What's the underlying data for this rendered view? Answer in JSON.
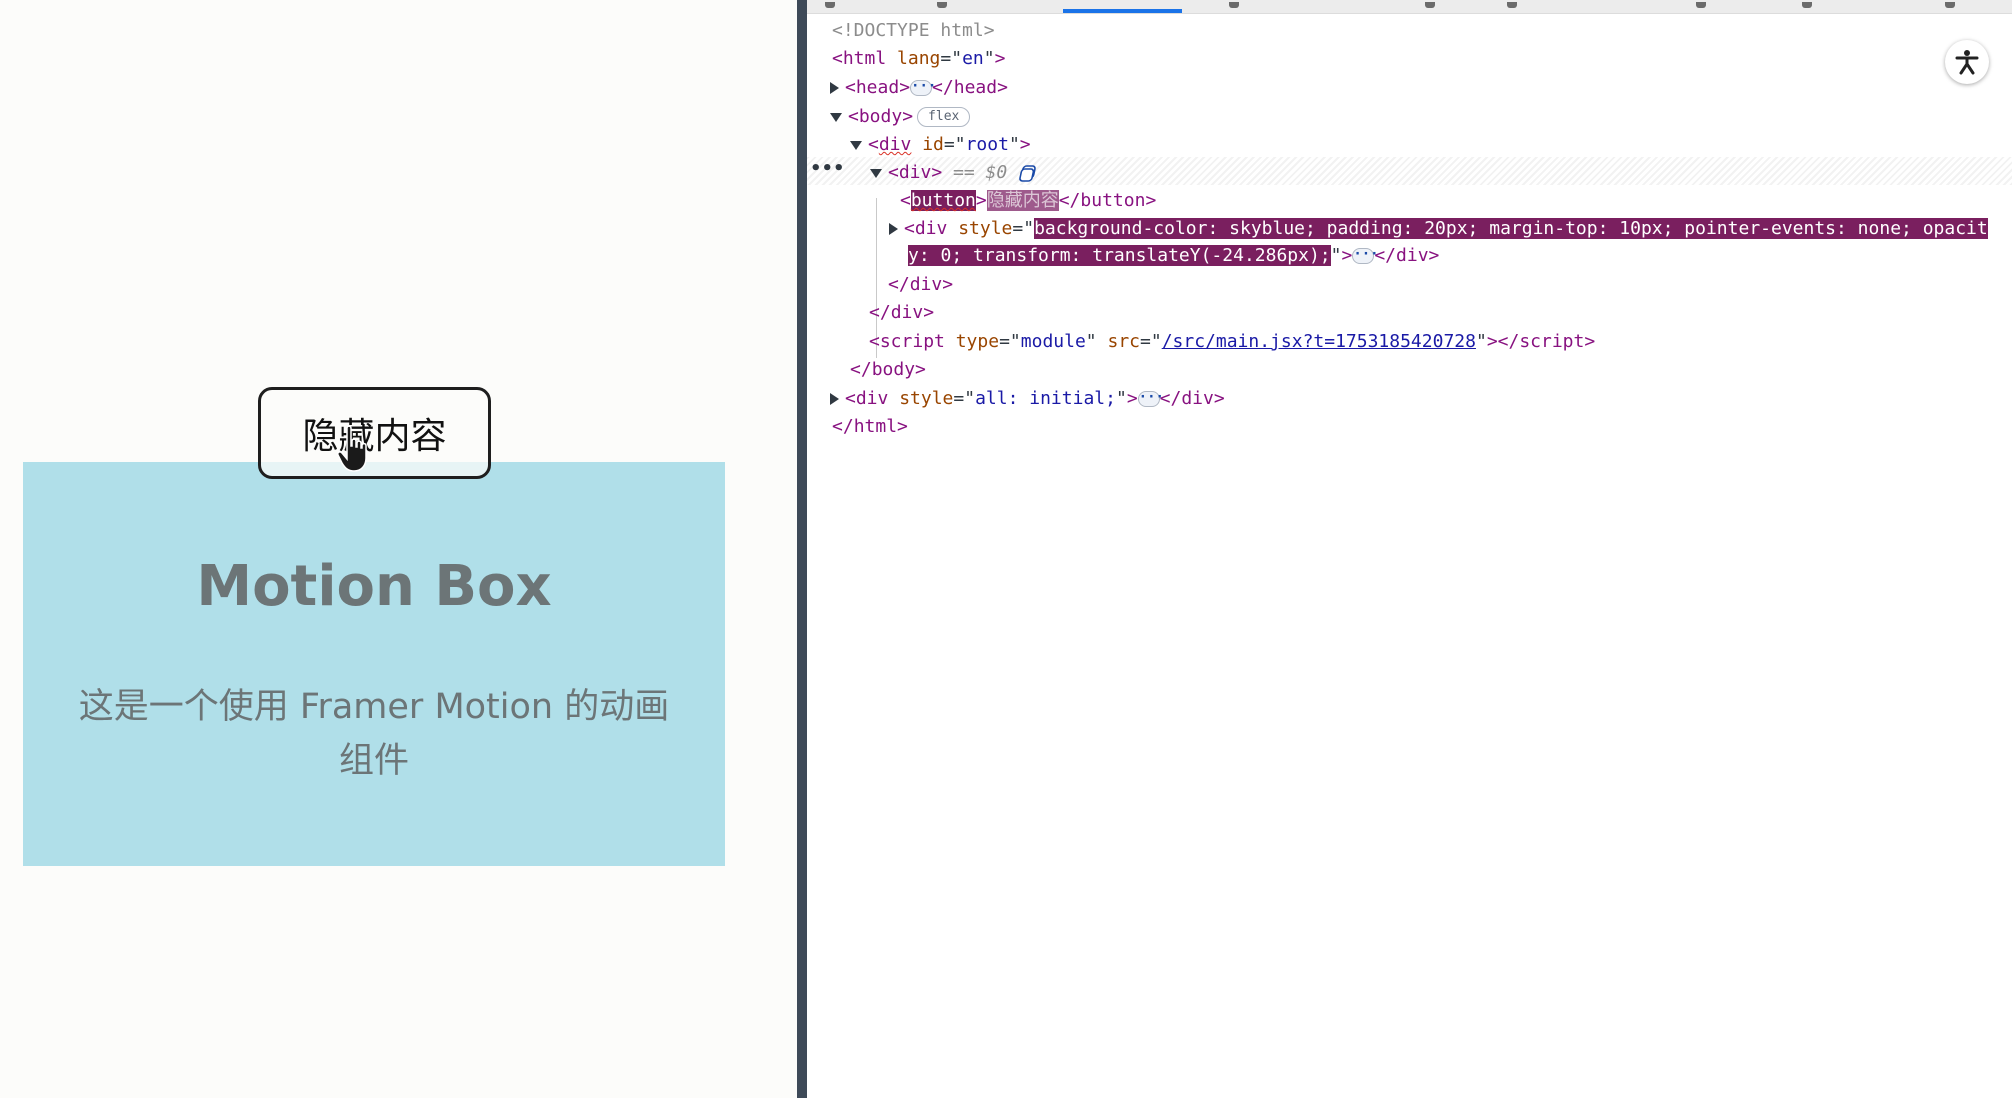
{
  "preview": {
    "button_label": "隐藏内容",
    "box_title": "Motion Box",
    "box_description": "这是一个使用 Framer Motion 的动画组件",
    "box_color": "#b0dfe9"
  },
  "devtools": {
    "active_tab_color": "#1a73e8",
    "selected_suffix": "== $0",
    "flex_badge": "flex",
    "lines": {
      "doctype": "<!DOCTYPE html>",
      "html_open_tag": "html",
      "html_lang_attr": "lang",
      "html_lang_val": "en",
      "head_tag": "head",
      "body_tag": "body",
      "div_tag": "div",
      "root_attr": "id",
      "root_val": "root",
      "button_tag": "button",
      "button_text": "隐藏内容",
      "style_attr": "style",
      "style_val_1": "background-color: skyblue; padding: 20px; margin-top: 10px; pointer-events: none; opacit",
      "style_val_2": "y: 0; transform: translateY(-24.286px);",
      "script_tag": "script",
      "script_type_attr": "type",
      "script_type_val": "module",
      "script_src_attr": "src",
      "script_src_val": "/src/main.jsx?t=1753185420728",
      "all_initial_val": "all: initial;"
    }
  }
}
